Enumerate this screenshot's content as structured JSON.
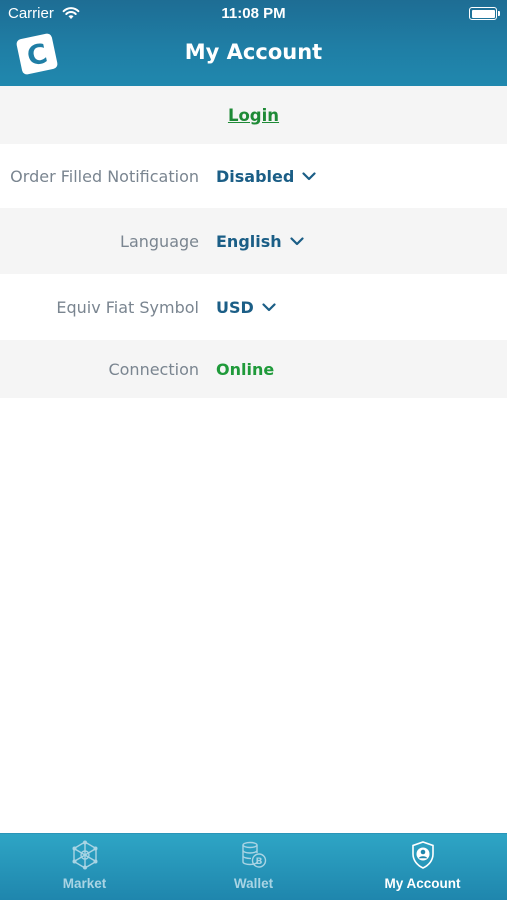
{
  "status_bar": {
    "carrier": "Carrier",
    "time": "11:08 PM"
  },
  "header": {
    "title": "My Account",
    "logo_letter": "C"
  },
  "login": {
    "label": "Login"
  },
  "settings": {
    "order_filled_notification": {
      "label": "Order Filled Notification",
      "value": "Disabled"
    },
    "language": {
      "label": "Language",
      "value": "English"
    },
    "equiv_fiat_symbol": {
      "label": "Equiv Fiat Symbol",
      "value": "USD"
    },
    "connection": {
      "label": "Connection",
      "value": "Online"
    }
  },
  "tab_bar": {
    "tabs": [
      {
        "label": "Market",
        "icon": "network-icon",
        "active": false
      },
      {
        "label": "Wallet",
        "icon": "coins-icon",
        "active": false
      },
      {
        "label": "My Account",
        "icon": "shield-user-icon",
        "active": true
      }
    ]
  },
  "colors": {
    "header": "#1f7ea5",
    "value_blue": "#1b5e86",
    "online_green": "#1f9a3a",
    "login_green": "#1e8a36",
    "label_gray": "#7a8590",
    "row_gray": "#f5f5f5"
  }
}
